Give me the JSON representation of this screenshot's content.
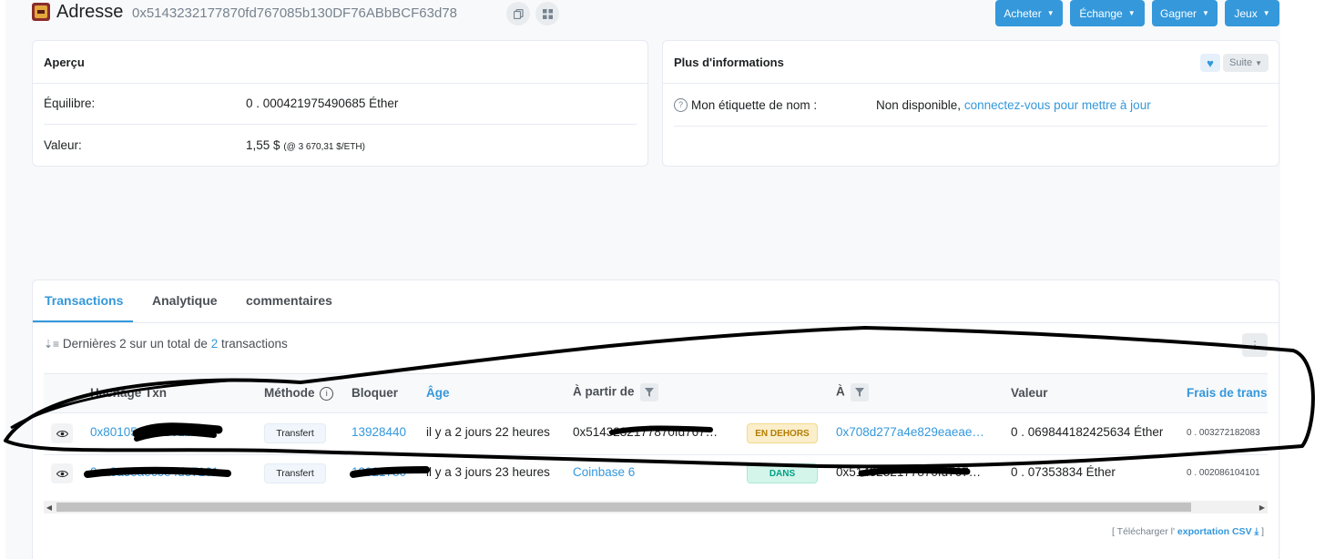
{
  "header": {
    "title": "Adresse",
    "address": "0x5143232177870fd767085b130DF76ABbBCF63d78",
    "buttons": [
      {
        "label": "Acheter"
      },
      {
        "label": "Échange"
      },
      {
        "label": "Gagner"
      },
      {
        "label": "Jeux"
      }
    ]
  },
  "overview": {
    "title": "Aperçu",
    "balance_label": "Équilibre:",
    "balance_value": "0 . 000421975490685 Éther",
    "value_label": "Valeur:",
    "value_amount": "1,55 $",
    "value_rate": "(@ 3 670,31 $/ETH)"
  },
  "more_info": {
    "title": "Plus d'informations",
    "suite_label": "Suite",
    "name_tag_label": "Mon étiquette de nom :",
    "name_tag_value": "Non disponible,",
    "name_tag_link": "connectez-vous pour mettre à jour"
  },
  "tabs": [
    {
      "label": "Transactions"
    },
    {
      "label": "Analytique"
    },
    {
      "label": "commentaires"
    }
  ],
  "summary": {
    "prefix": "Dernières 2 sur un total de",
    "count": "2",
    "suffix": "transactions"
  },
  "table": {
    "headers": {
      "hash": "Hachage Txn",
      "method": "Méthode",
      "block": "Bloquer",
      "age": "Âge",
      "from": "À partir de",
      "to": "À",
      "value": "Valeur",
      "fee": "Frais de trans"
    },
    "rows": [
      {
        "hash": "0x80105a6c0e61ba1…",
        "method": "Transfert",
        "block": "13928440",
        "age": "il y a 2 jours 22 heures",
        "from": "0x5143232177870fd767…",
        "direction": "EN DEHORS",
        "to": "0x708d277a4e829eaeae…",
        "value": "0 . 069844182425634 Éther",
        "fee": "0 . 003272182083"
      },
      {
        "hash": "0xa8a3eaecee4d37161…",
        "method": "Transfert",
        "block": "13921780",
        "age": "il y a 3 jours 23 heures",
        "from": "Coinbase 6",
        "direction": "DANS",
        "to": "0x5143232177870fd767…",
        "value": "0 . 07353834 Éther",
        "fee": "0 . 002086104101"
      }
    ]
  },
  "csv": {
    "prefix": "[ Télécharger l'",
    "link": "exportation CSV",
    "suffix": "]"
  }
}
